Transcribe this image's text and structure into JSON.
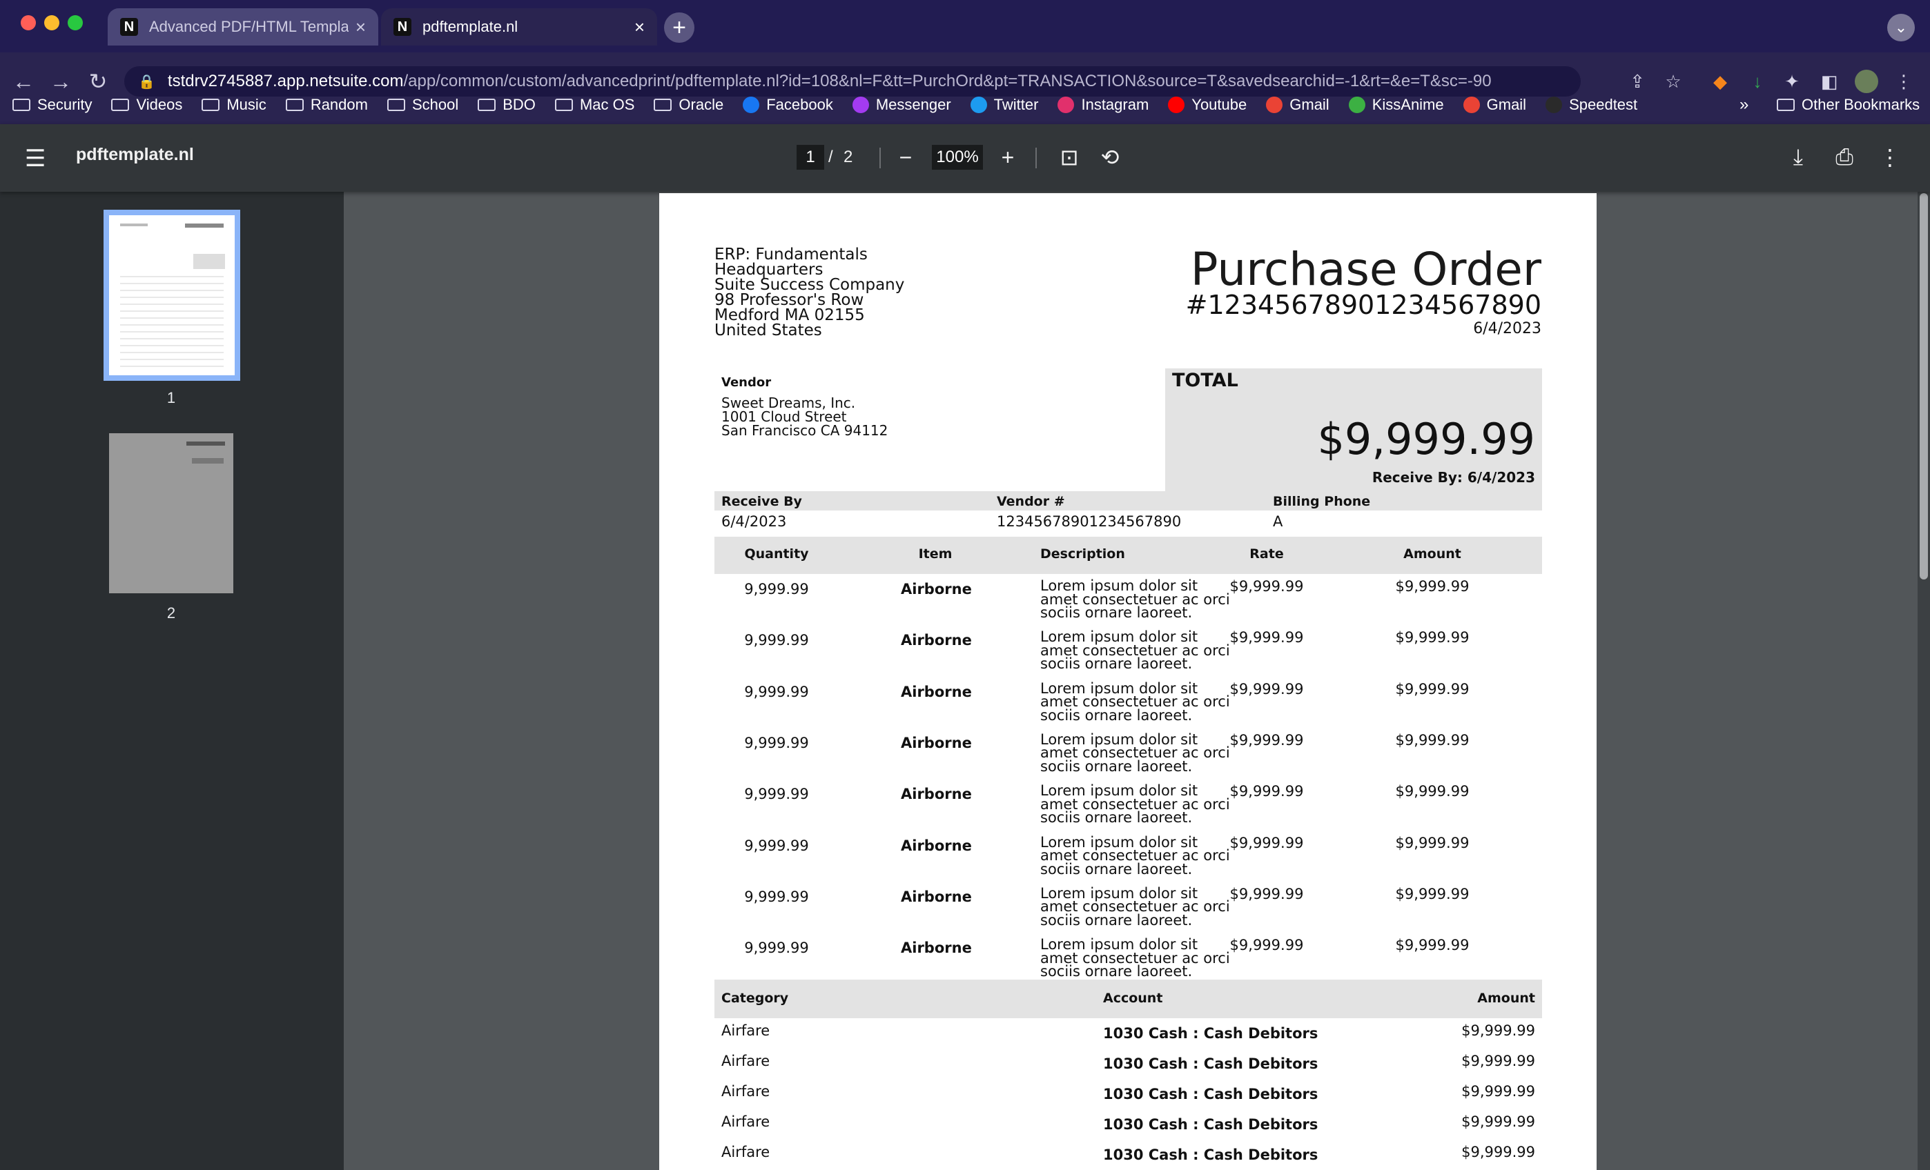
{
  "tabs": [
    {
      "icon": "N",
      "title": "Advanced PDF/HTML Template",
      "active": false
    },
    {
      "icon": "N",
      "title": "pdftemplate.nl",
      "active": true
    }
  ],
  "address": {
    "host": "tstdrv2745887.app.netsuite.com",
    "path": "/app/common/custom/advancedprint/pdftemplate.nl?id=108&nl=F&tt=PurchOrd&pt=TRANSACTION&source=T&savedsearchid=-1&rt=&e=T&sc=-90"
  },
  "bookmarks": [
    {
      "icon": "folder-icon",
      "label": "Security"
    },
    {
      "icon": "folder-icon",
      "label": "Videos"
    },
    {
      "icon": "folder-icon",
      "label": "Music"
    },
    {
      "icon": "folder-icon",
      "label": "Random"
    },
    {
      "icon": "folder-icon",
      "label": "School"
    },
    {
      "icon": "folder-icon",
      "label": "BDO"
    },
    {
      "icon": "folder-icon",
      "label": "Mac OS"
    },
    {
      "icon": "folder-icon",
      "label": "Oracle"
    },
    {
      "icon": "facebook-icon",
      "label": "Facebook",
      "color": "#1877f2"
    },
    {
      "icon": "messenger-icon",
      "label": "Messenger",
      "color": "#a33bf0"
    },
    {
      "icon": "twitter-icon",
      "label": "Twitter",
      "color": "#1d9bf0"
    },
    {
      "icon": "instagram-icon",
      "label": "Instagram",
      "color": "#e1306c"
    },
    {
      "icon": "youtube-icon",
      "label": "Youtube",
      "color": "#ff0000"
    },
    {
      "icon": "gmail-icon",
      "label": "Gmail",
      "color": "#ea4335"
    },
    {
      "icon": "kissanime-icon",
      "label": "KissAnime",
      "color": "#3cb043"
    },
    {
      "icon": "gmail-icon",
      "label": "Gmail",
      "color": "#ea4335"
    },
    {
      "icon": "speedtest-icon",
      "label": "Speedtest",
      "color": "#2a2a2a"
    }
  ],
  "bookmarks_more": "»",
  "bookmarks_other": "Other Bookmarks",
  "pdf": {
    "filename": "pdftemplate.nl",
    "current_page": "1",
    "separator": "/",
    "total_pages": "2",
    "zoom": "100%",
    "thumbnails": [
      {
        "label": "1"
      },
      {
        "label": "2"
      }
    ]
  },
  "document": {
    "company_lines": [
      "ERP: Fundamentals",
      "Headquarters",
      "Suite Success Company",
      "98 Professor's Row",
      "Medford MA 02155",
      "United States"
    ],
    "title": "Purchase Order",
    "number": "#12345678901234567890",
    "date": "6/4/2023",
    "vendor_label": "Vendor",
    "vendor_lines": [
      "Sweet Dreams, Inc.",
      "1001 Cloud Street",
      "San Francisco CA 94112"
    ],
    "total_label": "TOTAL",
    "total_value": "$9,999.99",
    "receive_by_summary": "Receive By: 6/4/2023",
    "info_headers": [
      "Receive By",
      "Vendor #",
      "Billing Phone"
    ],
    "info_values": [
      "6/4/2023",
      "12345678901234567890",
      "A"
    ],
    "item_headers": [
      "Quantity",
      "Item",
      "Description",
      "Rate",
      "Amount"
    ],
    "items": [
      {
        "qty": "9,999.99",
        "item": "Airborne",
        "desc": [
          "Lorem ipsum dolor sit",
          "amet consectetuer ac orci",
          "sociis ornare laoreet."
        ],
        "rate": "$9,999.99",
        "amount": "$9,999.99"
      },
      {
        "qty": "9,999.99",
        "item": "Airborne",
        "desc": [
          "Lorem ipsum dolor sit",
          "amet consectetuer ac orci",
          "sociis ornare laoreet."
        ],
        "rate": "$9,999.99",
        "amount": "$9,999.99"
      },
      {
        "qty": "9,999.99",
        "item": "Airborne",
        "desc": [
          "Lorem ipsum dolor sit",
          "amet consectetuer ac orci",
          "sociis ornare laoreet."
        ],
        "rate": "$9,999.99",
        "amount": "$9,999.99"
      },
      {
        "qty": "9,999.99",
        "item": "Airborne",
        "desc": [
          "Lorem ipsum dolor sit",
          "amet consectetuer ac orci",
          "sociis ornare laoreet."
        ],
        "rate": "$9,999.99",
        "amount": "$9,999.99"
      },
      {
        "qty": "9,999.99",
        "item": "Airborne",
        "desc": [
          "Lorem ipsum dolor sit",
          "amet consectetuer ac orci",
          "sociis ornare laoreet."
        ],
        "rate": "$9,999.99",
        "amount": "$9,999.99"
      },
      {
        "qty": "9,999.99",
        "item": "Airborne",
        "desc": [
          "Lorem ipsum dolor sit",
          "amet consectetuer ac orci",
          "sociis ornare laoreet."
        ],
        "rate": "$9,999.99",
        "amount": "$9,999.99"
      },
      {
        "qty": "9,999.99",
        "item": "Airborne",
        "desc": [
          "Lorem ipsum dolor sit",
          "amet consectetuer ac orci",
          "sociis ornare laoreet."
        ],
        "rate": "$9,999.99",
        "amount": "$9,999.99"
      },
      {
        "qty": "9,999.99",
        "item": "Airborne",
        "desc": [
          "Lorem ipsum dolor sit",
          "amet consectetuer ac orci",
          "sociis ornare laoreet."
        ],
        "rate": "$9,999.99",
        "amount": "$9,999.99"
      }
    ],
    "expense_headers": [
      "Category",
      "Account",
      "Amount"
    ],
    "expenses": [
      {
        "category": "Airfare",
        "account": "1030 Cash : Cash Debitors",
        "amount": "$9,999.99"
      },
      {
        "category": "Airfare",
        "account": "1030 Cash : Cash Debitors",
        "amount": "$9,999.99"
      },
      {
        "category": "Airfare",
        "account": "1030 Cash : Cash Debitors",
        "amount": "$9,999.99"
      },
      {
        "category": "Airfare",
        "account": "1030 Cash : Cash Debitors",
        "amount": "$9,999.99"
      },
      {
        "category": "Airfare",
        "account": "1030 Cash : Cash Debitors",
        "amount": "$9,999.99"
      }
    ]
  }
}
